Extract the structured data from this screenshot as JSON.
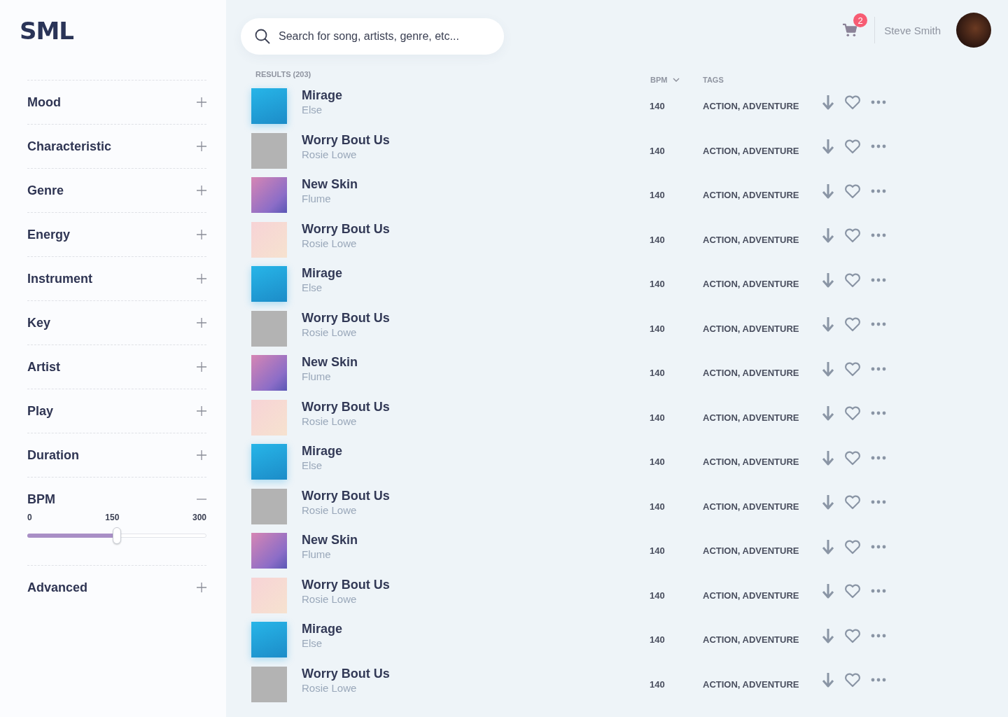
{
  "logo": "SML",
  "filters": [
    {
      "label": "Mood",
      "expanded": false
    },
    {
      "label": "Characteristic",
      "expanded": false
    },
    {
      "label": "Genre",
      "expanded": false
    },
    {
      "label": "Energy",
      "expanded": false
    },
    {
      "label": "Instrument",
      "expanded": false
    },
    {
      "label": "Key",
      "expanded": false
    },
    {
      "label": "Artist",
      "expanded": false
    },
    {
      "label": "Play",
      "expanded": false
    },
    {
      "label": "Duration",
      "expanded": false
    },
    {
      "label": "BPM",
      "expanded": true,
      "range": {
        "min": "0",
        "mid": "150",
        "max": "300",
        "level": 0.5
      }
    },
    {
      "label": "Advanced",
      "expanded": false
    }
  ],
  "search": {
    "placeholder": "Search for song, artists, genre, etc..."
  },
  "cart": {
    "count": "2"
  },
  "user": {
    "name": "Steve Smith"
  },
  "results": {
    "label": "RESULTS (203)",
    "columns": [
      "BPM",
      "TAGS"
    ],
    "rows": [
      {
        "kind": "blue",
        "title": "Mirage",
        "artist": "Else",
        "bpm": "140",
        "tags": "ACTION, ADVENTURE"
      },
      {
        "kind": "gray",
        "title": "Worry Bout Us",
        "artist": "Rosie Lowe",
        "bpm": "140",
        "tags": "ACTION, ADVENTURE"
      },
      {
        "kind": "purple",
        "title": "New Skin",
        "artist": "Flume",
        "bpm": "140",
        "tags": "ACTION, ADVENTURE"
      },
      {
        "kind": "pink",
        "title": "Worry Bout Us",
        "artist": "Rosie Lowe",
        "bpm": "140",
        "tags": "ACTION, ADVENTURE"
      },
      {
        "kind": "blue",
        "title": "Mirage",
        "artist": "Else",
        "bpm": "140",
        "tags": "ACTION, ADVENTURE"
      },
      {
        "kind": "gray",
        "title": "Worry Bout Us",
        "artist": "Rosie Lowe",
        "bpm": "140",
        "tags": "ACTION, ADVENTURE"
      },
      {
        "kind": "purple",
        "title": "New Skin",
        "artist": "Flume",
        "bpm": "140",
        "tags": "ACTION, ADVENTURE"
      },
      {
        "kind": "pink",
        "title": "Worry Bout Us",
        "artist": "Rosie Lowe",
        "bpm": "140",
        "tags": "ACTION, ADVENTURE"
      },
      {
        "kind": "blue",
        "title": "Mirage",
        "artist": "Else",
        "bpm": "140",
        "tags": "ACTION, ADVENTURE"
      },
      {
        "kind": "gray",
        "title": "Worry Bout Us",
        "artist": "Rosie Lowe",
        "bpm": "140",
        "tags": "ACTION, ADVENTURE"
      },
      {
        "kind": "purple",
        "title": "New Skin",
        "artist": "Flume",
        "bpm": "140",
        "tags": "ACTION, ADVENTURE"
      },
      {
        "kind": "pink",
        "title": "Worry Bout Us",
        "artist": "Rosie Lowe",
        "bpm": "140",
        "tags": "ACTION, ADVENTURE"
      },
      {
        "kind": "blue",
        "title": "Mirage",
        "artist": "Else",
        "bpm": "140",
        "tags": "ACTION, ADVENTURE"
      },
      {
        "kind": "gray",
        "title": "Worry Bout Us",
        "artist": "Rosie Lowe",
        "bpm": "140",
        "tags": "ACTION, ADVENTURE"
      }
    ]
  }
}
